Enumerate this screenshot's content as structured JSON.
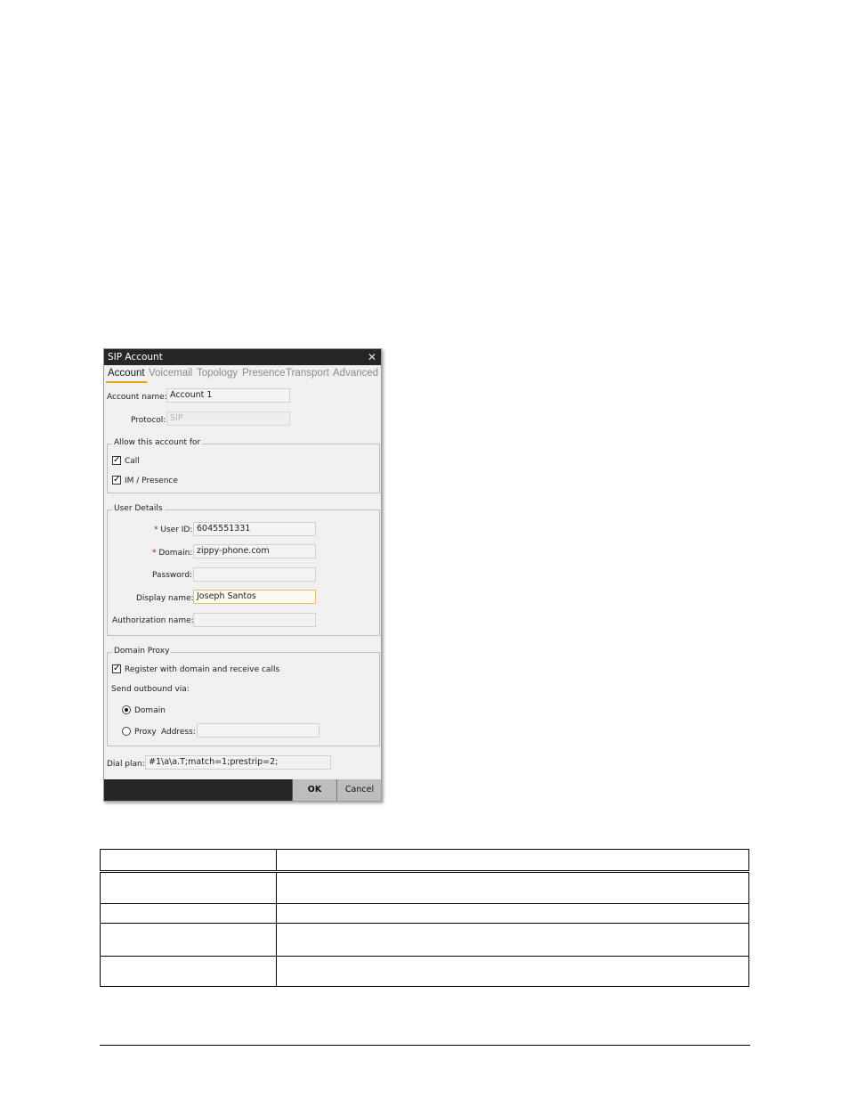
{
  "dialog": {
    "title": "SIP Account",
    "close_glyph": "✕",
    "tabs": [
      {
        "label": "Account",
        "active": true
      },
      {
        "label": "Voicemail",
        "active": false
      },
      {
        "label": "Topology",
        "active": false
      },
      {
        "label": "Presence",
        "active": false
      },
      {
        "label": "Transport",
        "active": false
      },
      {
        "label": "Advanced",
        "active": false
      }
    ],
    "account": {
      "account_name_label": "Account name:",
      "account_name_value": "Account 1",
      "protocol_label": "Protocol:",
      "protocol_value": "SIP"
    },
    "allow": {
      "legend": "Allow this account for",
      "call_label": "Call",
      "call_checked": true,
      "im_label": "IM / Presence",
      "im_checked": true
    },
    "user_details": {
      "legend": "User Details",
      "required_mark": "*",
      "user_id_label": "User ID:",
      "user_id_value": "6045551331",
      "domain_label": "Domain:",
      "domain_value": "zippy-phone.com",
      "password_label": "Password:",
      "password_value": "",
      "display_name_label": "Display name:",
      "display_name_value": "Joseph Santos",
      "auth_name_label": "Authorization name:",
      "auth_name_value": ""
    },
    "domain_proxy": {
      "legend": "Domain Proxy",
      "register_label": "Register with domain and receive calls",
      "register_checked": true,
      "send_outbound_label": "Send outbound via:",
      "domain_option_label": "Domain",
      "proxy_option_label": "Proxy",
      "selected_option": "Domain",
      "address_label": "Address:",
      "address_value": ""
    },
    "dial_plan": {
      "label": "Dial plan:",
      "value": "#1\\a\\a.T;match=1;prestrip=2;"
    },
    "buttons": {
      "ok_label": "OK",
      "cancel_label": "Cancel"
    },
    "colors": {
      "titlebar": "#262626",
      "tab_accent": "#e8a317",
      "required": "#cc0000",
      "focus_border": "#e4c45a"
    }
  }
}
